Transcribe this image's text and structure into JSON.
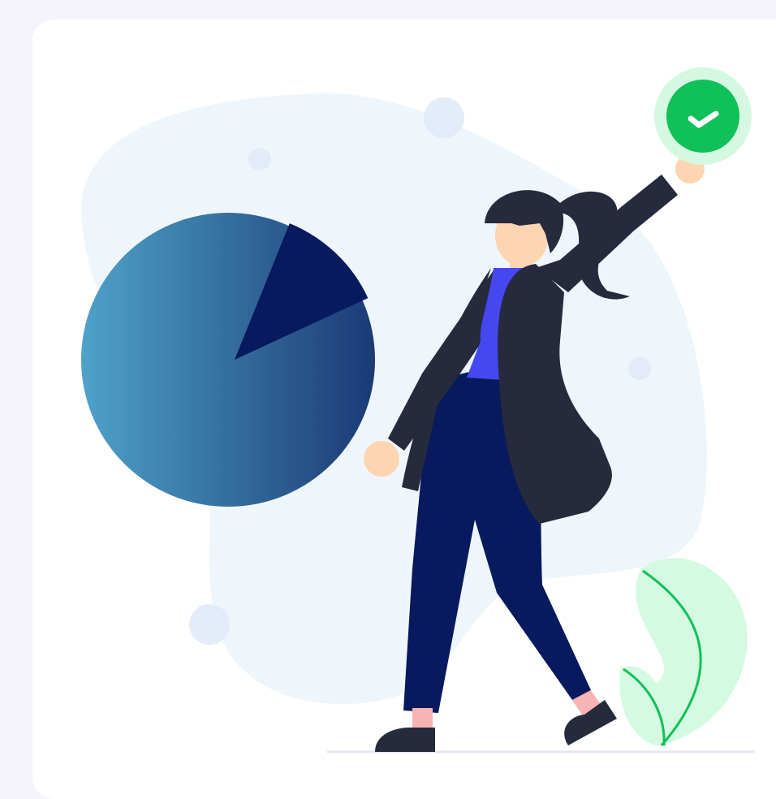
{
  "colors": {
    "page_background": "#f5f4fc",
    "card_background": "#ffffff",
    "blob": "#eef6fb",
    "bubble": "#dfe9f8",
    "pie_gradient_start": "#4ea2c9",
    "pie_gradient_end": "#1b3a75",
    "pie_slice": "#071a5e",
    "check_badge": "#10c058",
    "check_badge_halo": "#d5f8e2",
    "skin": "#fdd5b0",
    "hair": "#262a3d",
    "coat": "#262a3d",
    "top": "#4547f0",
    "pants": "#071a5e",
    "sock": "#f8b3b3",
    "shoe": "#262a3d",
    "leaf": "#d4fae2",
    "leaf_vein": "#10c058",
    "ground": "#e2e8f0"
  },
  "icons": [
    "check-icon"
  ],
  "chart_data": {
    "type": "pie",
    "values": [
      88,
      12
    ]
  }
}
